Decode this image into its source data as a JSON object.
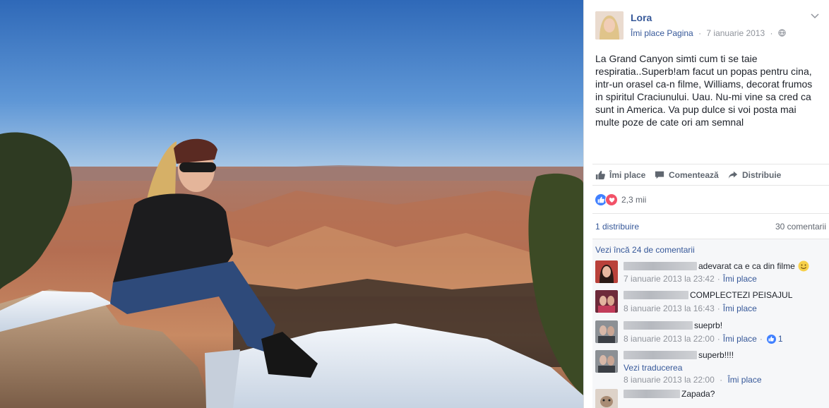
{
  "post": {
    "author": "Lora",
    "page_like": "Îmi place Pagina",
    "date": "7 ianuarie 2013",
    "separator": "·",
    "caption": "La Grand Canyon simti cum ti se taie respiratia..Superb!am facut un popas pentru cina, intr-un orasel ca-n filme, Williams, decorat frumos in spiritul Craciunului. Uau. Nu-mi vine sa cred ca sunt in America. Va pup dulce si voi posta mai multe poze de cate ori am semnal"
  },
  "actions": {
    "like": "Îmi place",
    "comment": "Comentează",
    "share": "Distribuie"
  },
  "reactions": {
    "count": "2,3 mii",
    "types": [
      "like",
      "love"
    ]
  },
  "stats": {
    "shares": "1 distribuire",
    "comments": "30 comentarii"
  },
  "comments": {
    "more_link": "Vezi încă 24 de comentarii",
    "items": [
      {
        "text": "adevarat ca e ca din filme",
        "emoji": "smiley",
        "date": "7 ianuarie 2013 la 23:42",
        "like": "Îmi place"
      },
      {
        "text": "COMPLECTEZI PEISAJUL",
        "date": "8 ianuarie 2013 la 16:43",
        "like": "Îmi place"
      },
      {
        "text": "sueprb!",
        "date": "8 ianuarie 2013 la 22:00",
        "like": "Îmi place",
        "likes": "1"
      },
      {
        "text": "superb!!!!",
        "translate": "Vezi traducerea",
        "date": "8 ianuarie 2013 la 22:00",
        "like": "Îmi place"
      },
      {
        "text": "Zapada?"
      }
    ]
  },
  "colors": {
    "link": "#365899",
    "like_blue": "#4080ff",
    "love_red": "#f25268",
    "meta_gray": "#90949c"
  },
  "icons": [
    "globe-icon",
    "chevron-down-icon",
    "thumbs-up-icon",
    "comment-icon",
    "share-icon",
    "like-reaction-icon",
    "love-reaction-icon",
    "smiley-emoji-icon"
  ]
}
